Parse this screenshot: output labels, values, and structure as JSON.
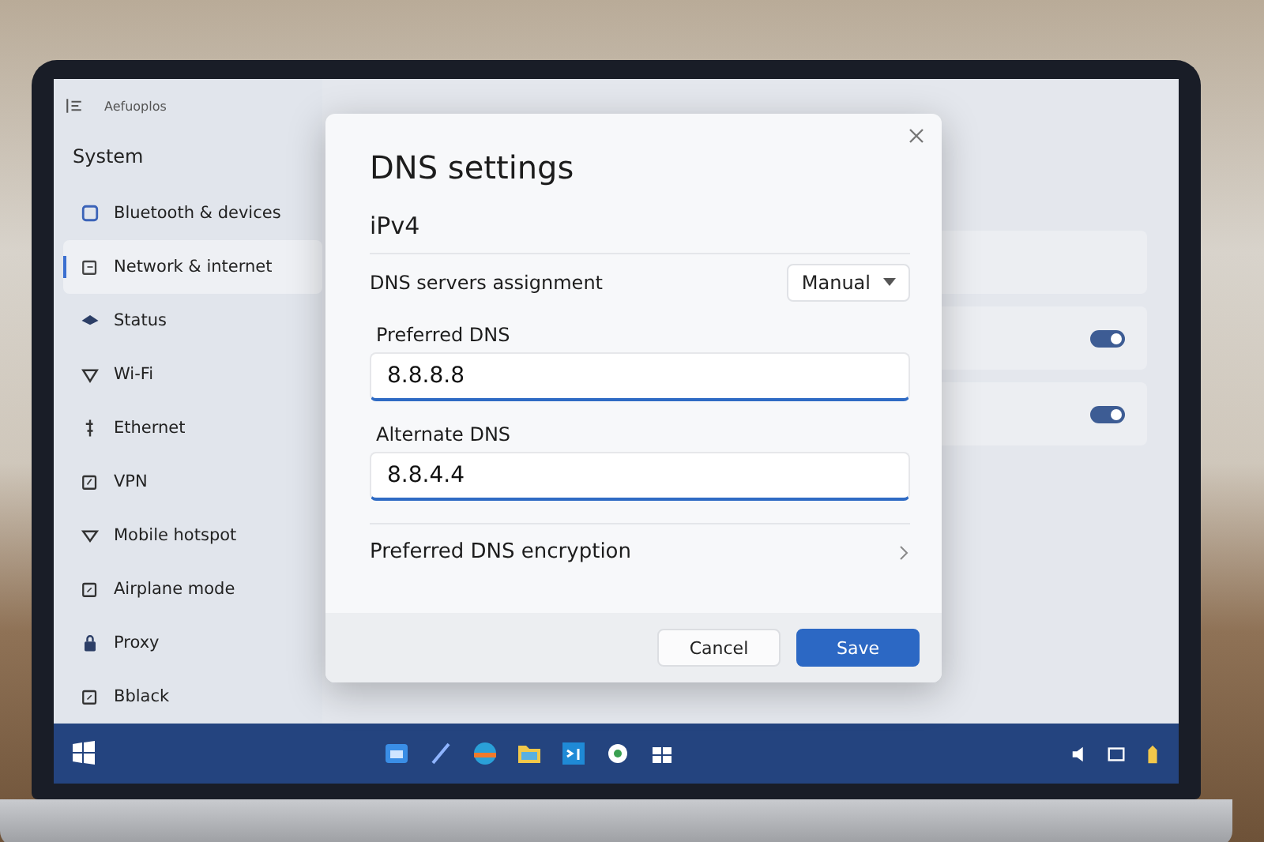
{
  "app": {
    "title": "Aefuoplos"
  },
  "sidebar": {
    "heading": "System",
    "items": [
      {
        "label": "Bluetooth & devices",
        "selected": false
      },
      {
        "label": "Network & internet",
        "selected": true
      },
      {
        "label": "Status",
        "selected": false
      },
      {
        "label": "Wi-Fi",
        "selected": false
      },
      {
        "label": "Ethernet",
        "selected": false
      },
      {
        "label": "VPN",
        "selected": false
      },
      {
        "label": "Mobile hotspot",
        "selected": false
      },
      {
        "label": "Airplane mode",
        "selected": false
      },
      {
        "label": "Proxy",
        "selected": false
      },
      {
        "label": "Bblack",
        "selected": false
      }
    ]
  },
  "settings_rows": [
    {
      "on": true
    },
    {
      "on": true
    }
  ],
  "dialog": {
    "title": "DNS settings",
    "section": "iPv4",
    "assignment": {
      "label": "DNS servers assignment",
      "value": "Manual"
    },
    "fields": [
      {
        "label": "Preferred DNS",
        "value": "8.8.8.8"
      },
      {
        "label": "Alternate DNS",
        "value": "8.8.4.4"
      }
    ],
    "encryption": {
      "label": "Preferred DNS encryption"
    },
    "buttons": [
      {
        "label": "Cancel",
        "kind": "secondary"
      },
      {
        "label": "Save",
        "kind": "primary"
      }
    ]
  }
}
